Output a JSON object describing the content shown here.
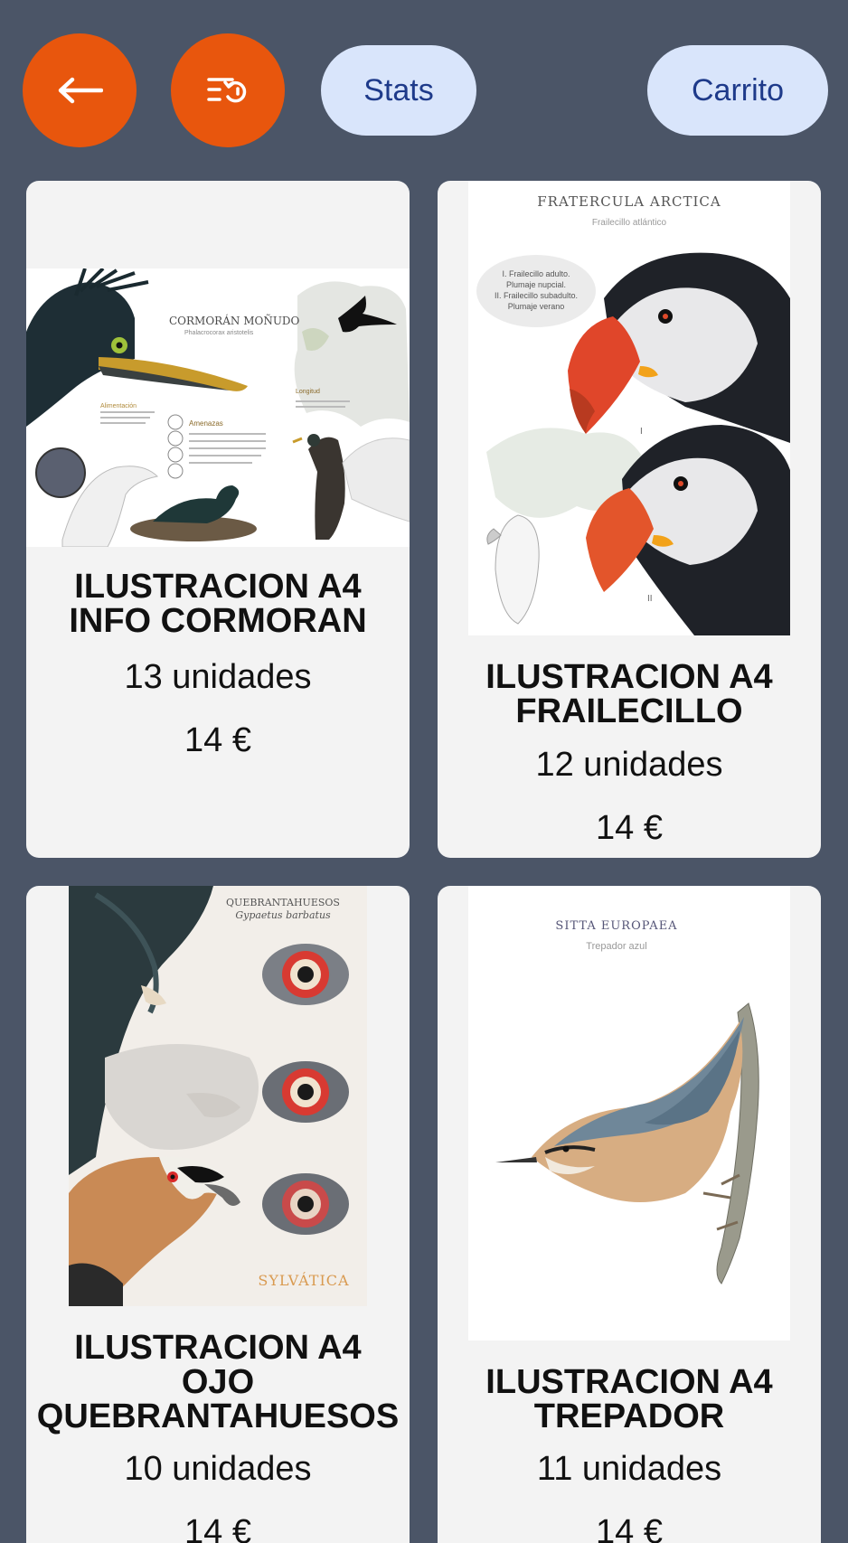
{
  "toolbar": {
    "back_icon": "arrow-left-icon",
    "sort_icon": "sort-reset-icon",
    "stats_label": "Stats",
    "cart_label": "Carrito",
    "accent_color": "#e8560d",
    "pill_color": "#d9e5fb"
  },
  "products": [
    {
      "title_line1": "ILUSTRACION A4",
      "title_line2": "INFO CORMORAN",
      "quantity": "13 unidades",
      "price": "14 €",
      "art": {
        "heading": "CORMORÁN MOÑUDO",
        "subheading": "Phalacrocorax aristotelis",
        "label_food": "Alimentación",
        "label_threats": "Amenazas",
        "label_length": "Longitud"
      }
    },
    {
      "title_line1": "ILUSTRACION A4",
      "title_line2": "FRAILECILLO",
      "quantity": "12 unidades",
      "price": "14 €",
      "art": {
        "heading": "FRATERCULA ARCTICA",
        "subheading": "Frailecillo atlántico",
        "note_1": "I. Frailecillo adulto.",
        "note_2": "Plumaje nupcial.",
        "note_3": "II. Frailecillo subadulto.",
        "note_4": "Plumaje verano",
        "mark_1": "I",
        "mark_2": "II"
      }
    },
    {
      "title_line1": "ILUSTRACION A4",
      "title_line2": "OJO",
      "title_line3": "QUEBRANTAHUESOS",
      "quantity": "10 unidades",
      "price": "14 €",
      "art": {
        "heading": "QUEBRANTAHUESOS",
        "subheading": "Gypaetus barbatus",
        "brand": "SYLVÁTICA"
      }
    },
    {
      "title_line1": "ILUSTRACION A4",
      "title_line2": "TREPADOR",
      "quantity": "11 unidades",
      "price": "14 €",
      "art": {
        "heading": "SITTA EUROPAEA",
        "subheading": "Trepador azul"
      }
    }
  ]
}
